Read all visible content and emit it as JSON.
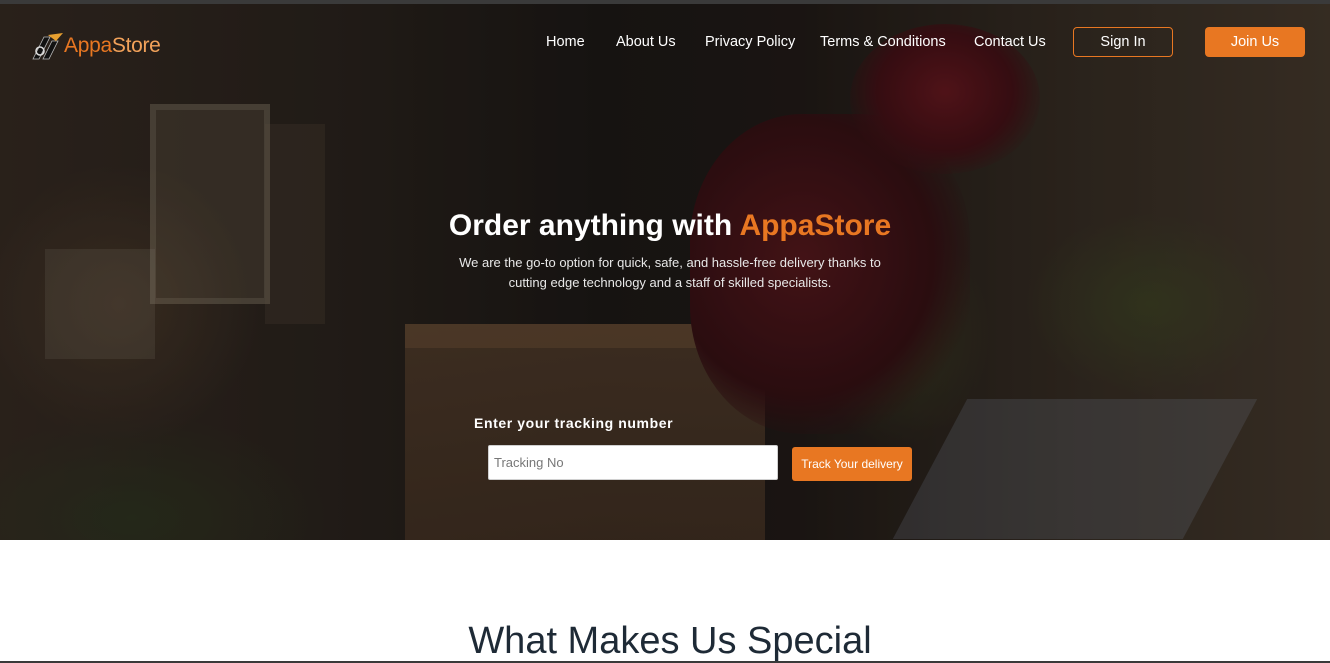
{
  "brand": {
    "name_part1": "Appa",
    "name_part2": "Store",
    "accent_color": "#e87722"
  },
  "nav": {
    "items": [
      {
        "label": "Home"
      },
      {
        "label": "About Us"
      },
      {
        "label": "Privacy Policy"
      },
      {
        "label": "Terms & Conditions"
      },
      {
        "label": "Contact Us"
      }
    ],
    "sign_in_label": "Sign In",
    "join_label": "Join Us"
  },
  "hero": {
    "headline_prefix": "Order anything with ",
    "headline_accent": "AppaStore",
    "subtext": "We are the go-to option for quick, safe, and hassle-free delivery thanks to cutting edge technology and a staff of skilled specialists.",
    "tracking_label": "Enter your tracking number",
    "tracking_placeholder": "Tracking No",
    "tracking_button": "Track Your delivery"
  },
  "section": {
    "title": "What Makes Us Special"
  }
}
